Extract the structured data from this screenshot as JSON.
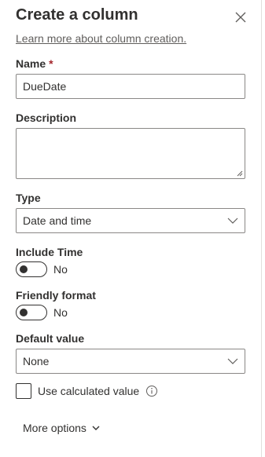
{
  "panel": {
    "title": "Create a column",
    "learn_more": "Learn more about column creation.",
    "close_icon": "close-icon"
  },
  "name_field": {
    "label": "Name",
    "required_marker": "*",
    "value": "DueDate"
  },
  "description_field": {
    "label": "Description",
    "value": ""
  },
  "type_field": {
    "label": "Type",
    "selected": "Date and time"
  },
  "include_time": {
    "label": "Include Time",
    "state_text": "No",
    "on": false
  },
  "friendly_format": {
    "label": "Friendly format",
    "state_text": "No",
    "on": false
  },
  "default_value": {
    "label": "Default value",
    "selected": "None"
  },
  "calculated": {
    "label": "Use calculated value",
    "checked": false,
    "info_icon": "info-icon"
  },
  "more_options": {
    "label": "More options",
    "icon": "chevron-down-icon"
  },
  "colors": {
    "text": "#323130",
    "border": "#8a8886",
    "required": "#a4262c",
    "link": "#605e5c"
  }
}
